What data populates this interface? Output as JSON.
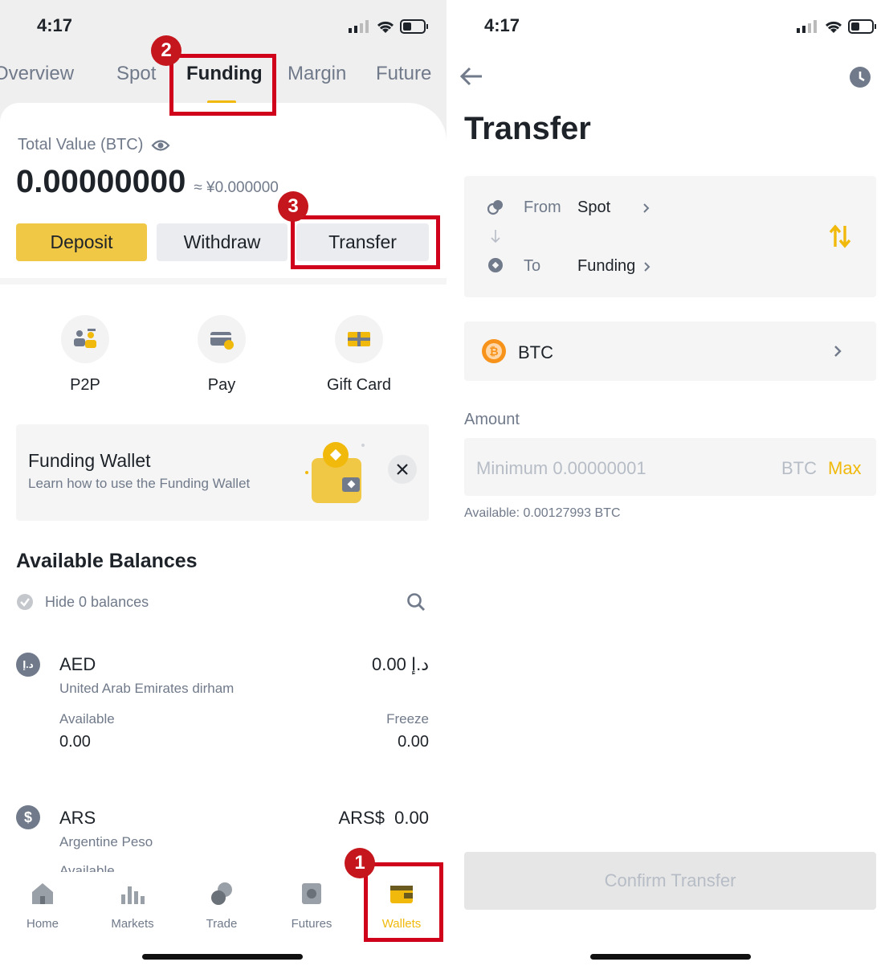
{
  "left": {
    "status_time": "4:17",
    "tabs": [
      {
        "label": "Overview"
      },
      {
        "label": "Spot"
      },
      {
        "label": "Funding"
      },
      {
        "label": "Margin"
      },
      {
        "label": "Future"
      }
    ],
    "total_value_label": "Total Value (BTC)",
    "total_value": "0.00000000",
    "fiat_value": "≈ ¥0.000000",
    "buttons": {
      "deposit": "Deposit",
      "withdraw": "Withdraw",
      "transfer": "Transfer"
    },
    "services": [
      {
        "label": "P2P",
        "icon": "p2p-icon"
      },
      {
        "label": "Pay",
        "icon": "pay-icon"
      },
      {
        "label": "Gift Card",
        "icon": "gift-card-icon"
      }
    ],
    "banner": {
      "title": "Funding Wallet",
      "subtitle": "Learn how to use the Funding Wallet"
    },
    "balances_title": "Available Balances",
    "hide_zero_label": "Hide 0 balances",
    "coins": [
      {
        "code": "AED",
        "name": "United Arab Emirates dirham",
        "amount": "0.00 د.إ",
        "available_label": "Available",
        "available": "0.00",
        "freeze_label": "Freeze",
        "freeze": "0.00"
      },
      {
        "code": "ARS",
        "name": "Argentine Peso",
        "amount": "ARS$  0.00",
        "available_label": "Available"
      }
    ],
    "bottom_nav": [
      {
        "label": "Home",
        "icon": "home-icon"
      },
      {
        "label": "Markets",
        "icon": "markets-icon"
      },
      {
        "label": "Trade",
        "icon": "trade-icon"
      },
      {
        "label": "Futures",
        "icon": "futures-icon"
      },
      {
        "label": "Wallets",
        "icon": "wallets-icon"
      }
    ],
    "annotations": [
      "1",
      "2",
      "3"
    ],
    "accent": "#f0b90b",
    "annotation_color": "#d0021b"
  },
  "right": {
    "status_time": "4:17",
    "title": "Transfer",
    "from_label": "From",
    "from_value": "Spot",
    "to_label": "To",
    "to_value": "Funding",
    "coin": "BTC",
    "amount_label": "Amount",
    "amount_placeholder": "Minimum 0.00000001",
    "amount_unit": "BTC",
    "max_label": "Max",
    "available_text": "Available: 0.00127993 BTC",
    "confirm_label": "Confirm Transfer"
  }
}
